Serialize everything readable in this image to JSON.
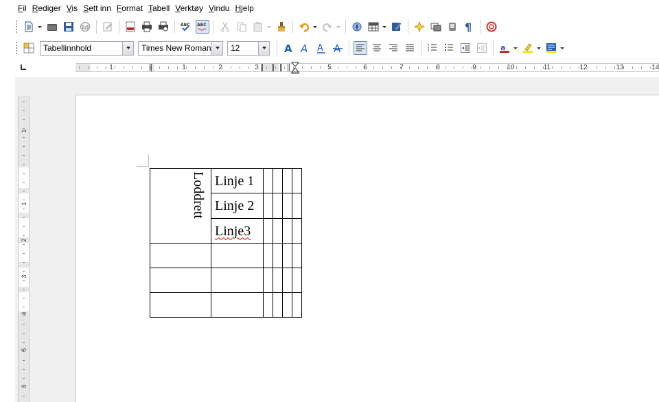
{
  "menu": [
    "Fil",
    "Rediger",
    "Vis",
    "Sett inn",
    "Format",
    "Tabell",
    "Verktøy",
    "Vindu",
    "Hjelp"
  ],
  "formatting": {
    "paragraph_style": "Tabellinnhold",
    "font_name": "Times New Roman",
    "font_size": "12"
  },
  "ruler": {
    "labels": [
      "1",
      "1",
      "2",
      "3",
      "5",
      "6",
      "7",
      "8",
      "9",
      "10",
      "11",
      "12",
      "13",
      "14"
    ],
    "vertical_labels": [
      "1",
      "1",
      "2",
      "3",
      "4",
      "5",
      "6"
    ]
  },
  "document": {
    "table": {
      "merged_cell_text": "Loddrett",
      "lines": [
        "Linje 1",
        "Linje 2",
        "Linje3"
      ]
    }
  },
  "icons": {
    "toolbar1": [
      "new-document-icon",
      "open-icon",
      "save-icon",
      "email-icon",
      "edit-file-icon",
      "export-pdf-icon",
      "print-icon",
      "print-preview-icon",
      "spellcheck-icon",
      "autospellcheck-icon",
      "cut-icon",
      "copy-icon",
      "paste-icon",
      "clone-formatting-icon",
      "undo-icon",
      "redo-icon",
      "navigator-icon",
      "table-icon",
      "draw-functions-icon",
      "gallery-icon",
      "data-sources-icon",
      "nonprinting-chars-icon",
      "help-icon"
    ],
    "toolbar2": [
      "styles-icon",
      "bold-icon",
      "italic-icon",
      "underline-icon",
      "strikethrough-icon",
      "align-left-icon",
      "align-center-icon",
      "align-right-icon",
      "justify-icon",
      "numbering-icon",
      "bullets-icon",
      "decrease-indent-icon",
      "increase-indent-icon",
      "font-color-icon",
      "highlight-icon",
      "background-color-icon"
    ]
  },
  "colors": {
    "accent": "#1f5fbf",
    "spellcheck_underline": "#d00000",
    "workspace": "#f0f0f0"
  }
}
